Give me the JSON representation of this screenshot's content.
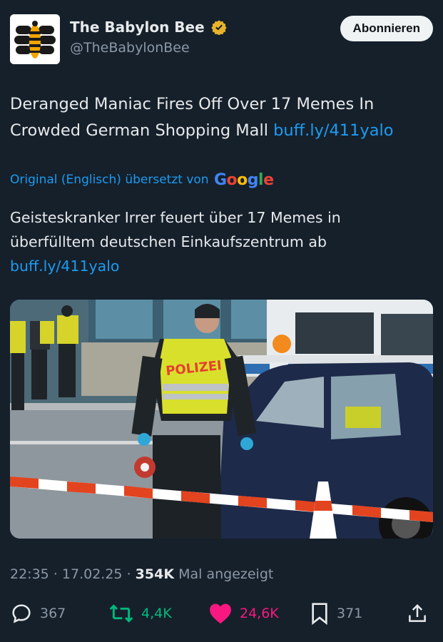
{
  "account": {
    "display_name": "The Babylon Bee",
    "handle": "@TheBabylonBee",
    "subscribe_label": "Abonnieren",
    "verified_color": "#e8b32a"
  },
  "tweet": {
    "text": "Deranged Maniac Fires Off Over 17 Memes In Crowded German Shopping Mall",
    "link": "buff.ly/411yalo",
    "translation_label": "Original (Englisch) übersetzt von",
    "translation_provider": "Google",
    "translated_text": "Geisteskranker Irrer feuert über 17 Memes in überfülltem deutschen Einkaufszentrum ab",
    "translated_link": "buff.ly/411yalo"
  },
  "media": {
    "police_label": "POLIZEI"
  },
  "meta": {
    "time": "22:35",
    "date": "17.02.25",
    "views": "354K",
    "views_label": "Mal angezeigt"
  },
  "actions": {
    "replies": "367",
    "retweets": "4,4K",
    "likes": "24,6K",
    "bookmarks": "371"
  },
  "colors": {
    "background": "#15202b",
    "link": "#1d9bf0",
    "retweet": "#00ba7c",
    "like": "#f91880",
    "muted": "#8b98a5"
  }
}
